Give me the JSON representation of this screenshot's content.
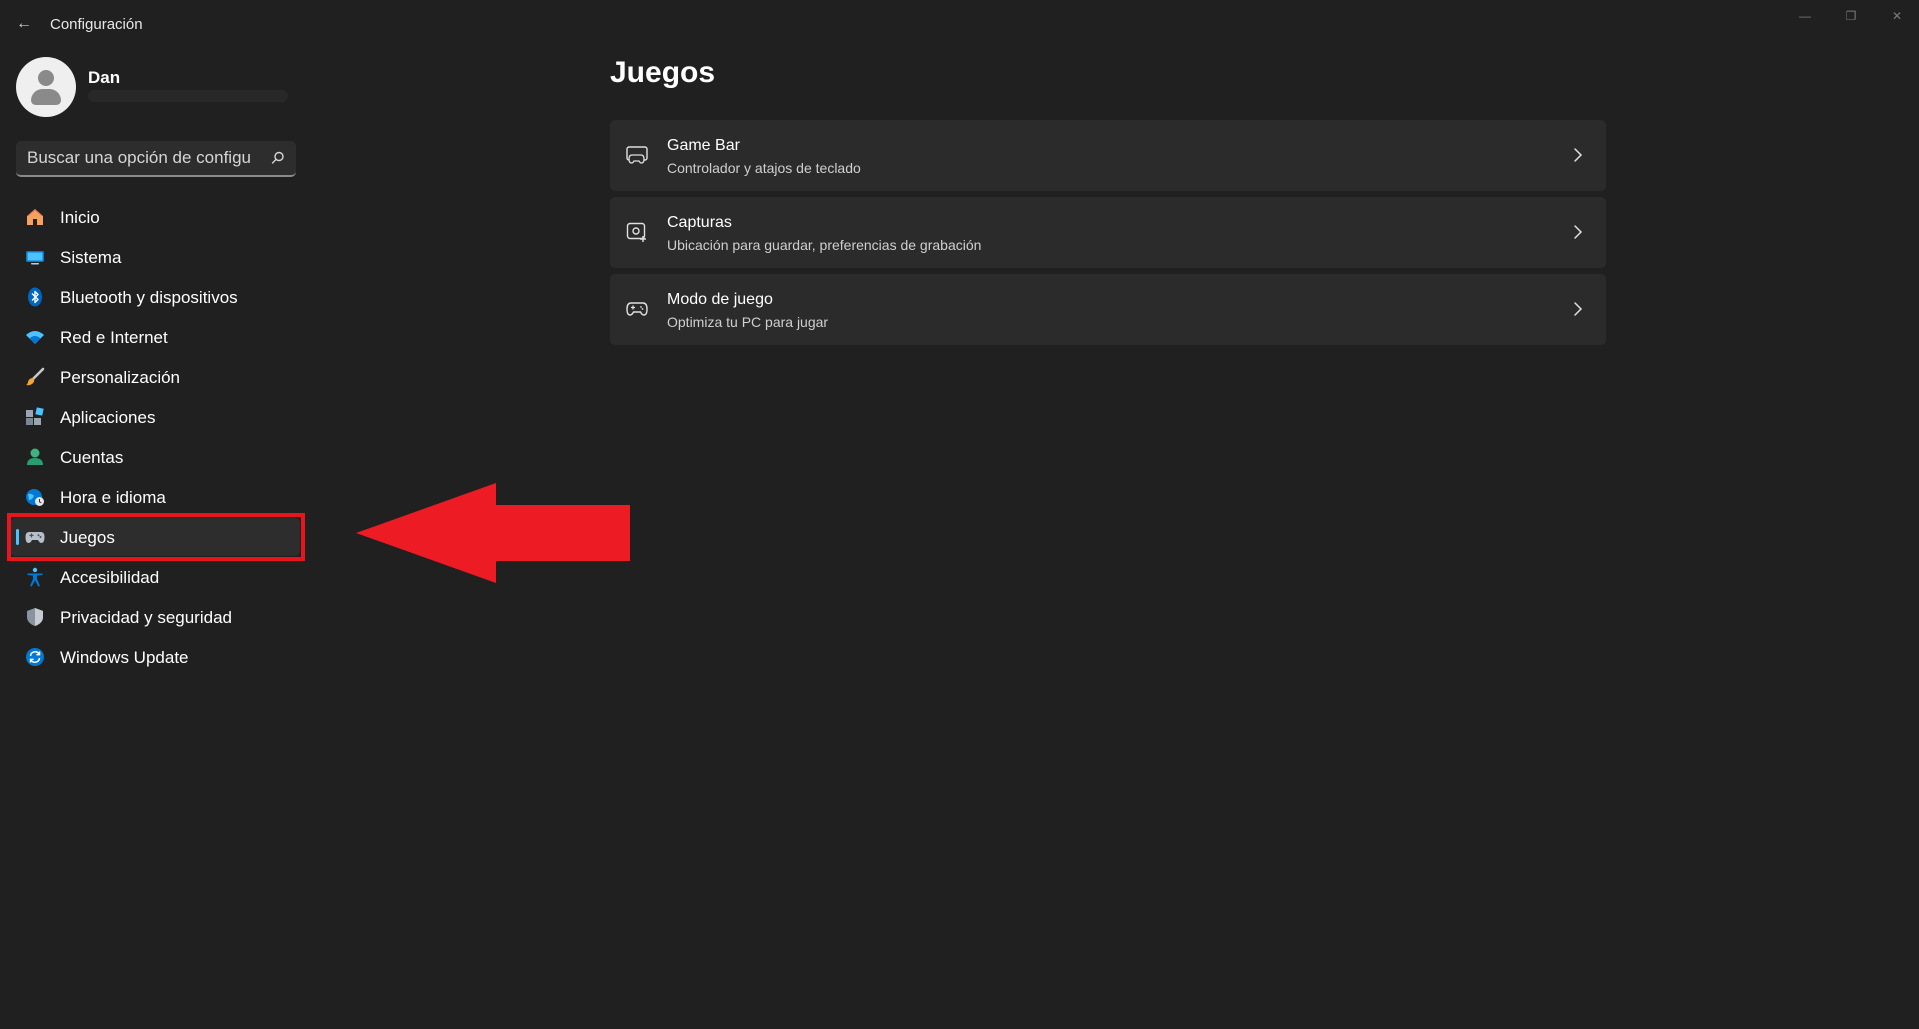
{
  "window": {
    "title": "Configuración",
    "back_glyph": "←",
    "min_glyph": "—",
    "max_glyph": "❐",
    "close_glyph": "✕"
  },
  "profile": {
    "name": "Dan"
  },
  "search": {
    "placeholder": "Buscar una opción de configu",
    "icon": "search-icon"
  },
  "nav": {
    "items": [
      {
        "label": "Inicio",
        "icon": "home-icon"
      },
      {
        "label": "Sistema",
        "icon": "system-icon"
      },
      {
        "label": "Bluetooth y dispositivos",
        "icon": "bluetooth-icon"
      },
      {
        "label": "Red e Internet",
        "icon": "wifi-icon"
      },
      {
        "label": "Personalización",
        "icon": "brush-icon"
      },
      {
        "label": "Aplicaciones",
        "icon": "apps-icon"
      },
      {
        "label": "Cuentas",
        "icon": "account-icon"
      },
      {
        "label": "Hora e idioma",
        "icon": "globe-clock-icon"
      },
      {
        "label": "Juegos",
        "icon": "gamepad-icon",
        "selected": true
      },
      {
        "label": "Accesibilidad",
        "icon": "accessibility-icon"
      },
      {
        "label": "Privacidad y seguridad",
        "icon": "shield-icon"
      },
      {
        "label": "Windows Update",
        "icon": "update-icon"
      }
    ]
  },
  "main": {
    "title": "Juegos",
    "cards": [
      {
        "title": "Game Bar",
        "subtitle": "Controlador y atajos de teclado",
        "icon": "game-bar-icon"
      },
      {
        "title": "Capturas",
        "subtitle": "Ubicación para guardar, preferencias de grabación",
        "icon": "capture-icon"
      },
      {
        "title": "Modo de juego",
        "subtitle": "Optimiza tu PC para jugar",
        "icon": "game-mode-icon"
      }
    ]
  },
  "colors": {
    "background": "#202020",
    "card": "#2b2b2b",
    "accent": "#4cc2ff",
    "annotation_red": "#e8151e"
  }
}
